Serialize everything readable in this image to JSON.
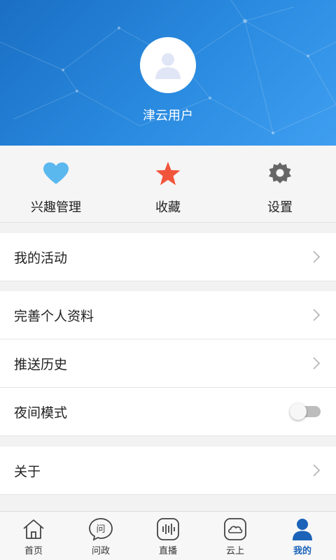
{
  "profile": {
    "username": "津云用户"
  },
  "quick_actions": [
    {
      "label": "兴趣管理",
      "icon": "heart-icon",
      "color": "#5bb8ef"
    },
    {
      "label": "收藏",
      "icon": "star-icon",
      "color": "#f0553c"
    },
    {
      "label": "设置",
      "icon": "gear-icon",
      "color": "#666666"
    }
  ],
  "menu": {
    "my_activity": "我的活动",
    "complete_profile": "完善个人资料",
    "push_history": "推送历史",
    "night_mode": "夜间模式",
    "night_mode_on": false,
    "about": "关于"
  },
  "tabbar": {
    "active_color": "#1a63b8",
    "items": [
      {
        "label": "首页",
        "icon": "home-icon"
      },
      {
        "label": "问政",
        "icon": "ask-bubble-icon"
      },
      {
        "label": "直播",
        "icon": "live-audio-icon"
      },
      {
        "label": "云上",
        "icon": "cloud-icon"
      },
      {
        "label": "我的",
        "icon": "user-icon"
      }
    ]
  }
}
